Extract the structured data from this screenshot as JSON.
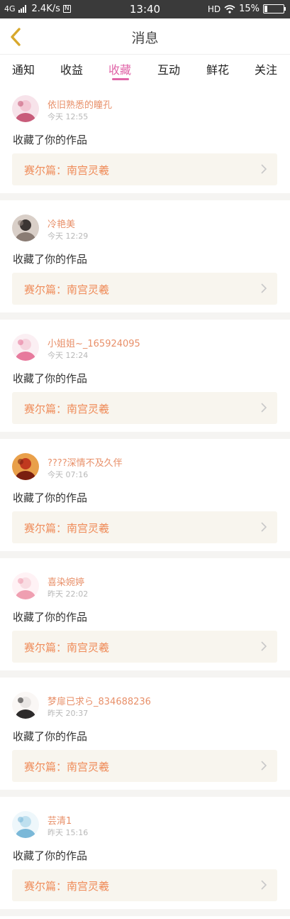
{
  "status_bar": {
    "network": "4G",
    "speed": "2.4K/s",
    "n_badge": "N",
    "time": "13:40",
    "hd": "HD",
    "battery": "15%",
    "battery_level": 0.15
  },
  "header": {
    "title": "消息"
  },
  "tabs": [
    {
      "label": "通知"
    },
    {
      "label": "收益"
    },
    {
      "label": "收藏"
    },
    {
      "label": "互动"
    },
    {
      "label": "鲜花"
    },
    {
      "label": "关注"
    }
  ],
  "active_tab": "收藏",
  "colors": {
    "accent": "#e065a8",
    "username": "#e8906a",
    "work_title": "#ef8c5a",
    "work_bg": "#f8f5ee"
  },
  "items": [
    {
      "name": "依旧熟悉的瞳孔",
      "time": "今天 12:55",
      "action": "收藏了你的作品",
      "work": "赛尔篇：南宫灵羲"
    },
    {
      "name": "冷艳美",
      "time": "今天 12:29",
      "action": "收藏了你的作品",
      "work": "赛尔篇：南宫灵羲"
    },
    {
      "name": "小姐姐~_165924095",
      "time": "今天 12:24",
      "action": "收藏了你的作品",
      "work": "赛尔篇：南宫灵羲"
    },
    {
      "name": "????深情不及久伴",
      "time": "今天 07:16",
      "action": "收藏了你的作品",
      "work": "赛尔篇：南宫灵羲"
    },
    {
      "name": "喜染婉婷",
      "time": "昨天 22:02",
      "action": "收藏了你的作品",
      "work": "赛尔篇：南宫灵羲"
    },
    {
      "name": "梦扉已求ら_834688236",
      "time": "昨天 20:37",
      "action": "收藏了你的作品",
      "work": "赛尔篇：南宫灵羲"
    },
    {
      "name": "芸清1",
      "time": "昨天 15:16",
      "action": "收藏了你的作品",
      "work": "赛尔篇：南宫灵羲"
    }
  ]
}
